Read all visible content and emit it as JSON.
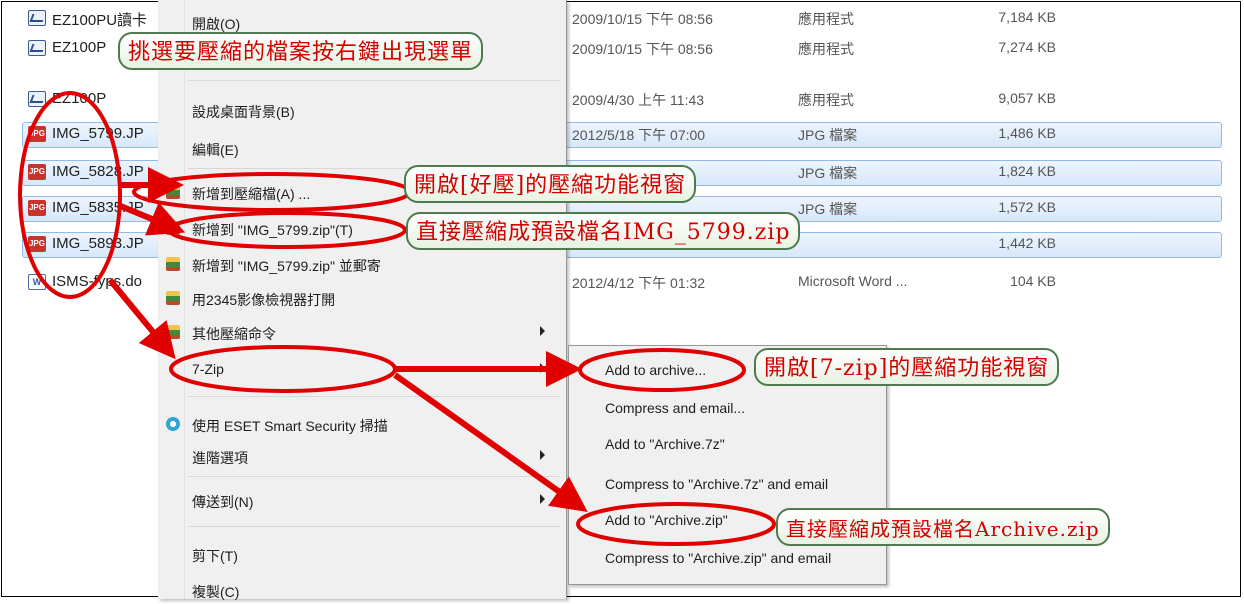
{
  "files": [
    {
      "name": "EZ100PU讀卡",
      "date": "2009/10/15 下午 08:56",
      "type": "應用程式",
      "size": "7,184 KB",
      "icon": "app-icon",
      "selected": false
    },
    {
      "name": "EZ100P",
      "date": "2009/10/15 下午 08:56",
      "type": "應用程式",
      "size": "7,274 KB",
      "icon": "app-icon",
      "selected": false
    },
    {
      "name": "EZ100P",
      "date": "2009/4/30 上午 11:43",
      "type": "應用程式",
      "size": "9,057 KB",
      "icon": "app-icon",
      "selected": false
    },
    {
      "name": "IMG_5799.JP",
      "date": "2012/5/18 下午 07:00",
      "type": "JPG 檔案",
      "size": "1,486 KB",
      "icon": "jpg-icon",
      "selected": true
    },
    {
      "name": "IMG_5828.JP",
      "date": "",
      "type": "JPG 檔案",
      "size": "1,824 KB",
      "icon": "jpg-icon",
      "selected": true
    },
    {
      "name": "IMG_5835.JP",
      "date": "",
      "type": "JPG 檔案",
      "size": "1,572 KB",
      "icon": "jpg-icon",
      "selected": true
    },
    {
      "name": "IMG_5893.JP",
      "date": "",
      "type": "",
      "size": "1,442 KB",
      "icon": "jpg-icon",
      "selected": true
    },
    {
      "name": "ISMS-fyps.do",
      "date": "2012/4/12 下午 01:32",
      "type": "Microsoft Word ...",
      "size": "104 KB",
      "icon": "word-doc-icon",
      "selected": false
    }
  ],
  "icon_text": {
    "jpg": "JPG",
    "doc": "W"
  },
  "context_menu": {
    "items": [
      {
        "label": "開啟(O)"
      },
      {
        "label": "設成桌面背景(B)"
      },
      {
        "label": "編輯(E)"
      },
      {
        "label": "新增到壓縮檔(A) ...",
        "icon": "archive-icon"
      },
      {
        "label": "新增到 \"IMG_5799.zip\"(T)",
        "icon": "archive-icon"
      },
      {
        "label": "新增到 \"IMG_5799.zip\" 並郵寄",
        "icon": "archive-icon"
      },
      {
        "label": "用2345影像檢視器打開",
        "icon": "archive-icon"
      },
      {
        "label": "其他壓縮命令",
        "icon": "archive-icon",
        "submenu": true
      },
      {
        "label": "7-Zip",
        "submenu": true
      },
      {
        "label": "使用 ESET Smart Security 掃描",
        "icon": "eset-icon"
      },
      {
        "label": "進階選項",
        "submenu": true
      },
      {
        "label": "傳送到(N)",
        "submenu": true
      },
      {
        "label": "剪下(T)"
      },
      {
        "label": "複製(C)"
      }
    ]
  },
  "submenu_7zip": {
    "items": [
      {
        "label": "Add to archive..."
      },
      {
        "label": "Compress and email..."
      },
      {
        "label": "Add to \"Archive.7z\""
      },
      {
        "label": "Compress to \"Archive.7z\" and email"
      },
      {
        "label": "Add to \"Archive.zip\""
      },
      {
        "label": "Compress to \"Archive.zip\" and email"
      }
    ]
  },
  "callouts": {
    "select_files": "挑選要壓縮的檔案按右鍵出現選單",
    "haozip_window": "開啟[好壓]的壓縮功能視窗",
    "default_name_img": "直接壓縮成預設檔名IMG_5799.zip",
    "sevenzip_window": "開啟[7-zip]的壓縮功能視窗",
    "default_name_archive": "直接壓縮成預設檔名Archive.zip"
  },
  "colors": {
    "annotation_red": "#e00000",
    "selection_blue": "#cfe3fb",
    "callout_border": "#4e7a4e",
    "callout_text": "#d40000"
  }
}
